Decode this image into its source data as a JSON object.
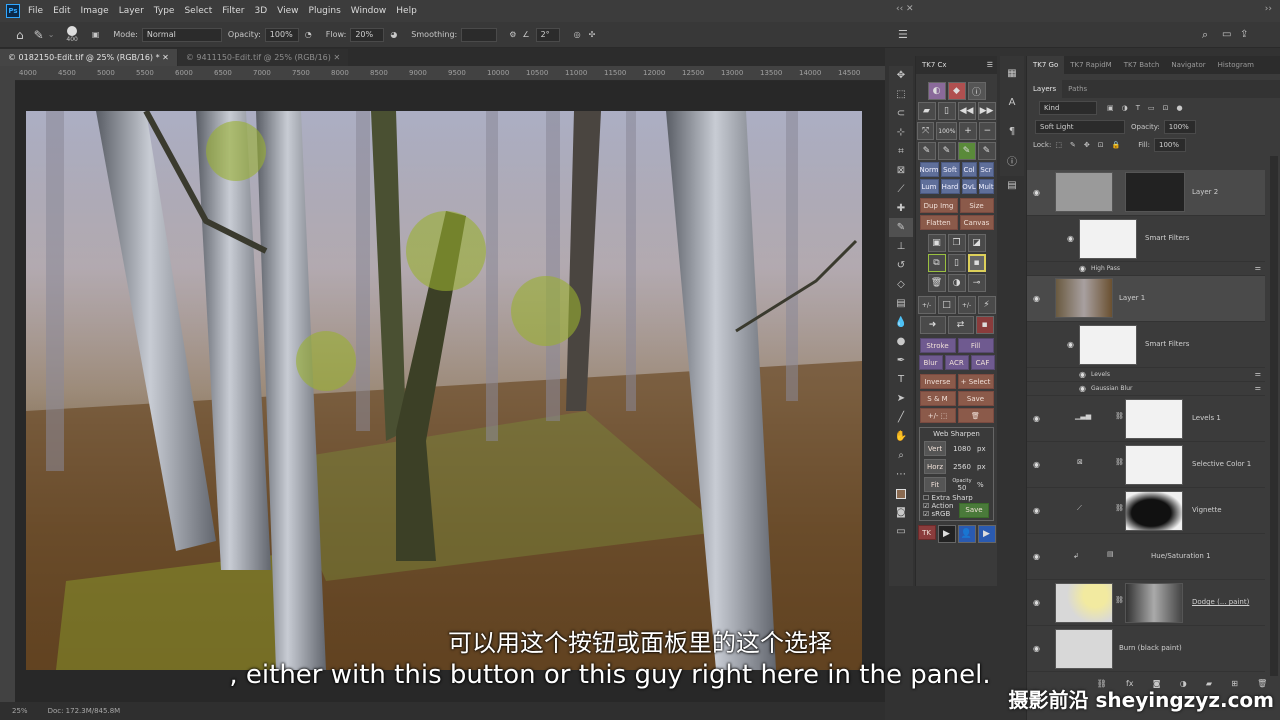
{
  "menu": {
    "items": [
      "File",
      "Edit",
      "Image",
      "Layer",
      "Type",
      "Select",
      "Filter",
      "3D",
      "View",
      "Plugins",
      "Window",
      "Help"
    ]
  },
  "options": {
    "brush_size": "400",
    "mode_label": "Mode:",
    "mode_value": "Normal",
    "opacity_label": "Opacity:",
    "opacity_value": "100%",
    "flow_label": "Flow:",
    "flow_value": "20%",
    "smoothing_label": "Smoothing:",
    "angle_value": "2°"
  },
  "doc_tabs": [
    {
      "label": "© 0182150-Edit.tif @ 25% (RGB/16) *"
    },
    {
      "label": "© 9411150-Edit.tif @ 25% (RGB/16)"
    }
  ],
  "ruler": {
    "ticks": [
      "4000",
      "4500",
      "5000",
      "5500",
      "6000",
      "6500",
      "7000",
      "7500",
      "8000",
      "8500",
      "9000",
      "9500",
      "10000",
      "10500",
      "11000",
      "11500",
      "12000",
      "12500",
      "13000",
      "13500",
      "14000",
      "14500"
    ]
  },
  "status": {
    "zoom": "25%",
    "doc": "Doc: 172.3M/845.8M"
  },
  "tk7": {
    "title": "TK7 Cx",
    "row_blend": [
      "Norm",
      "Soft",
      "Col",
      "Scr"
    ],
    "row_blend2": [
      "Lum",
      "Hard",
      "OvL",
      "Mult"
    ],
    "dup_img": "Dup Img",
    "size": "Size",
    "flatten": "Flatten",
    "canvas": "Canvas",
    "stroke": "Stroke",
    "fill": "Fill",
    "blur": "Blur",
    "acr": "ACR",
    "caf": "CAF",
    "inverse": "Inverse",
    "plus_select": "+ Select",
    "sm": "S & M",
    "save": "Save",
    "zoom_pct": "100%",
    "web_sharpen": {
      "title": "Web Sharpen",
      "vert": "Vert",
      "vert_val": "1080",
      "horz": "Horz",
      "horz_val": "2560",
      "px": "px",
      "fit": "Fit",
      "opacity": "Opacity",
      "opacity_val": "50",
      "pct": "%",
      "extra_sharp": "Extra Sharp",
      "action": "Action",
      "srgb": "sRGB",
      "save": "Save"
    },
    "bottom": "TK"
  },
  "right_tabs": {
    "items": [
      "TK7 Go",
      "TK7 RapidM",
      "TK7 Batch",
      "Navigator",
      "Histogram"
    ]
  },
  "layers_panel": {
    "tabs": [
      "Layers",
      "Paths"
    ],
    "kind": "Kind",
    "blend": "Soft Light",
    "opacity_label": "Opacity:",
    "opacity": "100%",
    "lock_label": "Lock:",
    "fill_label": "Fill:",
    "fill": "100%",
    "layers": [
      {
        "name": "Layer 2"
      },
      {
        "name": "Smart Filters"
      },
      {
        "name": "High Pass"
      },
      {
        "name": "Layer 1"
      },
      {
        "name": "Smart Filters"
      },
      {
        "name": "Levels"
      },
      {
        "name": "Gaussian Blur"
      },
      {
        "name": "Levels 1"
      },
      {
        "name": "Selective Color 1"
      },
      {
        "name": "Vignette"
      },
      {
        "name": "Hue/Saturation 1"
      },
      {
        "name": "Dodge (... paint)"
      },
      {
        "name": "Burn (black paint)"
      }
    ]
  },
  "subtitles": {
    "zh": "可以用这个按钮或面板里的这个选择",
    "en": ", either with this button or this guy right here in the panel."
  },
  "watermark": "摄影前沿 sheyingzyz.com"
}
